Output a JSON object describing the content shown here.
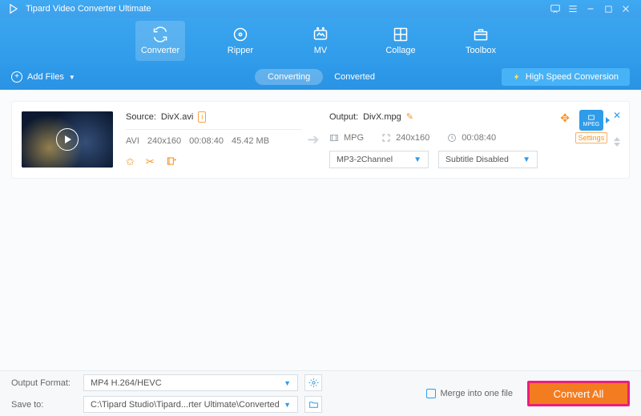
{
  "app": {
    "title": "Tipard Video Converter Ultimate"
  },
  "nav": {
    "converter": "Converter",
    "ripper": "Ripper",
    "mv": "MV",
    "collage": "Collage",
    "toolbox": "Toolbox"
  },
  "subbar": {
    "add_files": "Add Files",
    "converting": "Converting",
    "converted": "Converted",
    "high_speed": "High Speed Conversion"
  },
  "item": {
    "source_label": "Source:",
    "source_name": "DivX.avi",
    "codec": "AVI",
    "resolution": "240x160",
    "duration": "00:08:40",
    "size": "45.42 MB",
    "output_label": "Output:",
    "output_name": "DivX.mpg",
    "out_codec": "MPG",
    "out_resolution": "240x160",
    "out_duration": "00:08:40",
    "audio_select": "MP3-2Channel",
    "subtitle_select": "Subtitle Disabled",
    "format_badge": "MPEG",
    "settings_label": "Settings"
  },
  "bottom": {
    "output_format_label": "Output Format:",
    "output_format_value": "MP4 H.264/HEVC",
    "save_to_label": "Save to:",
    "save_to_value": "C:\\Tipard Studio\\Tipard...rter Ultimate\\Converted",
    "merge_label": "Merge into one file",
    "convert_all": "Convert All"
  }
}
